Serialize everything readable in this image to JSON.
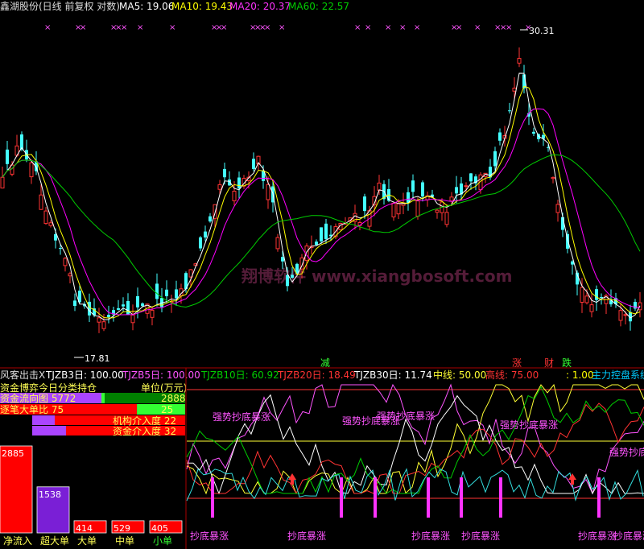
{
  "top_header": {
    "title": "鑫湖股份(日线 前复权 对数)",
    "ma5": "MA5: 19.06",
    "ma10": "MA10: 19.43",
    "ma20": "MA20: 20.37",
    "ma60": "MA60: 22.57"
  },
  "markers": {
    "row_glyph": "×",
    "high_label": "30.31",
    "low_label": "17.81"
  },
  "watermark": "翔博软件 www.xiangbosoft.com",
  "event_labels": {
    "jian": "减",
    "zhang": "涨",
    "cai": "财",
    "die": "跌"
  },
  "bottom_header": {
    "prefix": "风客出击X",
    "tjzb3": "TJZB3日: 100.00",
    "tjzb5": "TJZB5日: 100.00",
    "tjzb10": "TJZB10日: 60.92",
    "tjzb20": "TJZB20日: 18.49",
    "tjzb30": "TJZB30日: 11.74",
    "zhongxian": "中线: 50.00",
    "gaoxian": "高线: 75.00",
    "tail": ": 1.00",
    "system": "主力控盘系统"
  },
  "fund_panel": {
    "title": "资金博弈今日分类持仓",
    "unit": "单位(万元)",
    "rows": [
      {
        "label": "资金流向图 5772",
        "value": "2888"
      },
      {
        "label": "逐笔大单比 75",
        "value": "25"
      }
    ],
    "degrees": [
      {
        "label": "机构介入度 22"
      },
      {
        "label": "资金介入度 32"
      }
    ]
  },
  "bars": [
    {
      "name": "净流入",
      "value": "2885",
      "color": "#ff0000",
      "ratio": 1.0
    },
    {
      "name": "超大单",
      "value": "1538",
      "color": "#7a1fd6",
      "ratio": 0.53
    },
    {
      "name": "大单",
      "value": "414",
      "color": "#ff0000",
      "ratio": 0.14
    },
    {
      "name": "中单",
      "value": "529",
      "color": "#ff0000",
      "ratio": 0.14
    },
    {
      "name": "小单",
      "value": "405",
      "color": "#ff0000",
      "ratio": 0.14
    }
  ],
  "annotations": {
    "strong_bottom": "强势抄底暴涨",
    "bottom": "抄底暴涨"
  },
  "chart_data": [
    {
      "type": "candlestick",
      "title": "鑫湖股份(日线 前复权 对数)",
      "series": [
        {
          "name": "MA5",
          "color": "#ffffff",
          "latest": 19.06
        },
        {
          "name": "MA10",
          "color": "#ffff00",
          "latest": 19.43
        },
        {
          "name": "MA20",
          "color": "#ff00ff",
          "latest": 20.37
        },
        {
          "name": "MA60",
          "color": "#00cc00",
          "latest": 22.57
        }
      ],
      "price_max": 30.31,
      "price_min": 17.81,
      "log_scale": true
    },
    {
      "type": "line",
      "title": "风客出击X",
      "series": [
        {
          "name": "TJZB3日",
          "latest": 100.0
        },
        {
          "name": "TJZB5日",
          "latest": 100.0
        },
        {
          "name": "TJZB10日",
          "latest": 60.92
        },
        {
          "name": "TJZB20日",
          "latest": 18.49
        },
        {
          "name": "TJZB30日",
          "latest": 11.74
        }
      ],
      "reference_lines": [
        {
          "name": "中线",
          "value": 50.0
        },
        {
          "name": "高线",
          "value": 75.0
        }
      ]
    },
    {
      "type": "bar",
      "title": "资金博弈今日分类持仓",
      "categories": [
        "净流入",
        "超大单",
        "大单",
        "中单",
        "小单"
      ],
      "values": [
        2885,
        1538,
        414,
        529,
        405
      ]
    }
  ]
}
